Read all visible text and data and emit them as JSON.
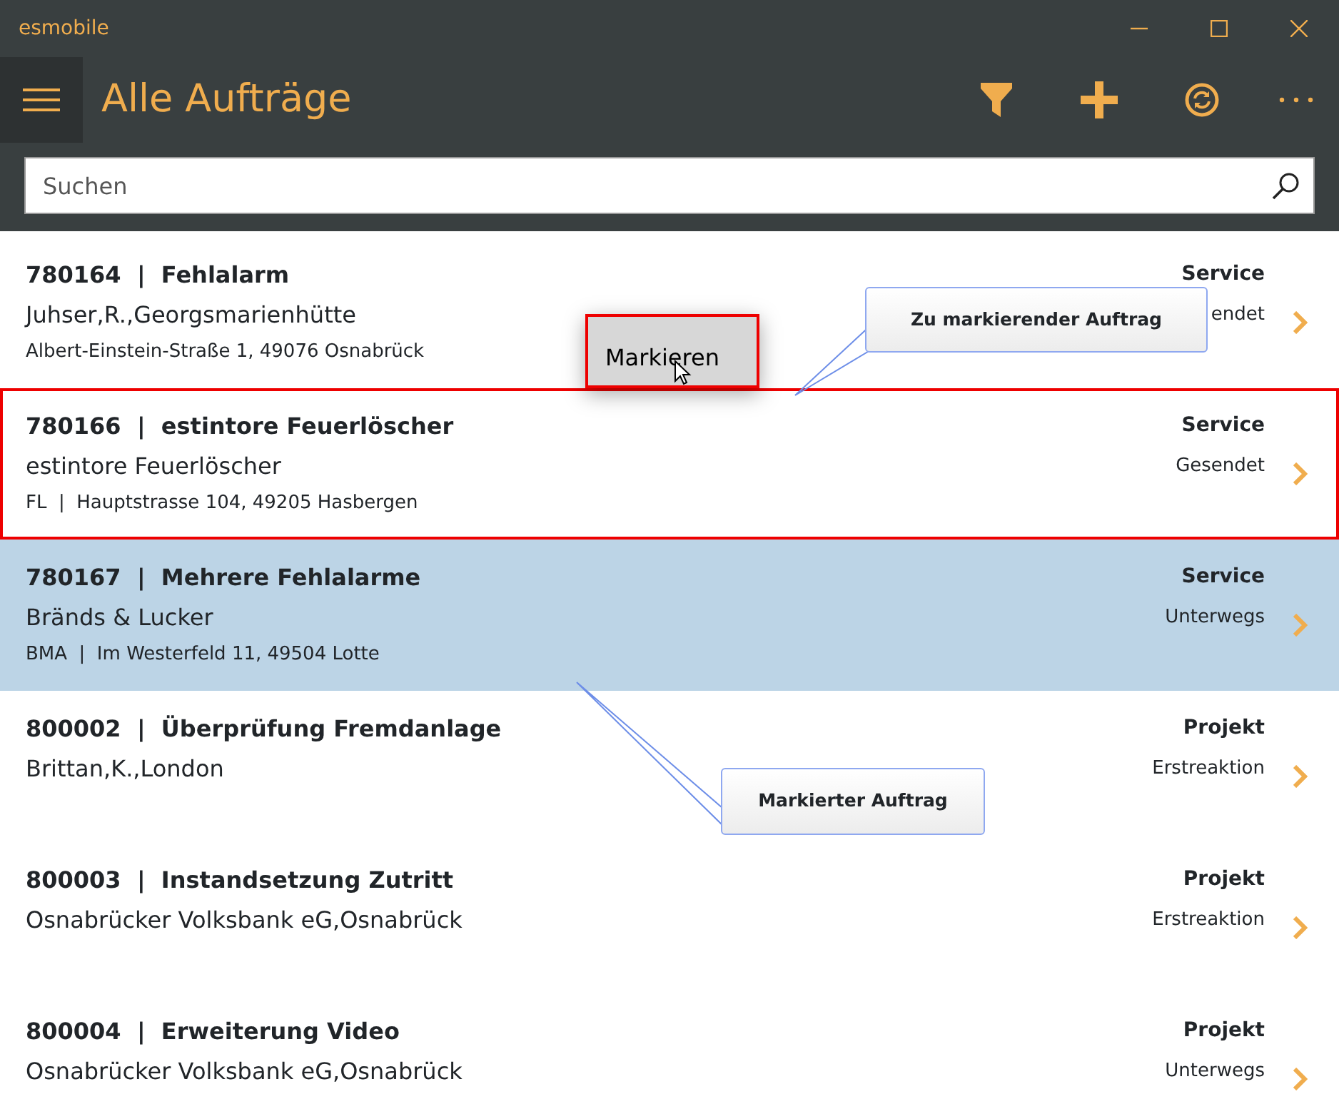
{
  "window": {
    "title": "esmobile"
  },
  "header": {
    "title": "Alle Aufträge"
  },
  "search": {
    "placeholder": "Suchen"
  },
  "orders": [
    {
      "title": "780164  |  Fehlalarm",
      "customer": "Juhser,R.,Georgsmarienhütte",
      "address": "Albert-Einstein-Straße 1, 49076 Osnabrück",
      "type": "Service",
      "status": "endet",
      "selected": false,
      "outlined": false
    },
    {
      "title": "780166  |  estintore Feuerlöscher",
      "customer": "estintore Feuerlöscher",
      "address": "FL  |  Hauptstrasse 104, 49205 Hasbergen",
      "type": "Service",
      "status": "Gesendet",
      "selected": false,
      "outlined": true
    },
    {
      "title": "780167  |  Mehrere Fehlalarme",
      "customer": "Bränds & Lucker",
      "address": "BMA  |  Im Westerfeld 11, 49504 Lotte",
      "type": "Service",
      "status": "Unterwegs",
      "selected": true,
      "outlined": false
    },
    {
      "title": "800002  |  Überprüfung Fremdanlage",
      "customer": "Brittan,K.,London",
      "type": "Projekt",
      "status": "Erstreaktion",
      "selected": false,
      "outlined": false
    },
    {
      "title": "800003  |  Instandsetzung Zutritt",
      "customer": "Osnabrücker Volksbank eG,Osnabrück",
      "type": "Projekt",
      "status": "Erstreaktion",
      "selected": false,
      "outlined": false
    },
    {
      "title": "800004  |  Erweiterung Video",
      "customer": "Osnabrücker Volksbank eG,Osnabrück",
      "type": "Projekt",
      "status": "Unterwegs",
      "selected": false,
      "outlined": false
    }
  ],
  "context_menu": {
    "items": [
      "Markieren"
    ]
  },
  "callouts": [
    {
      "text": "Zu markierender Auftrag"
    },
    {
      "text": "Markierter Auftrag"
    }
  ]
}
